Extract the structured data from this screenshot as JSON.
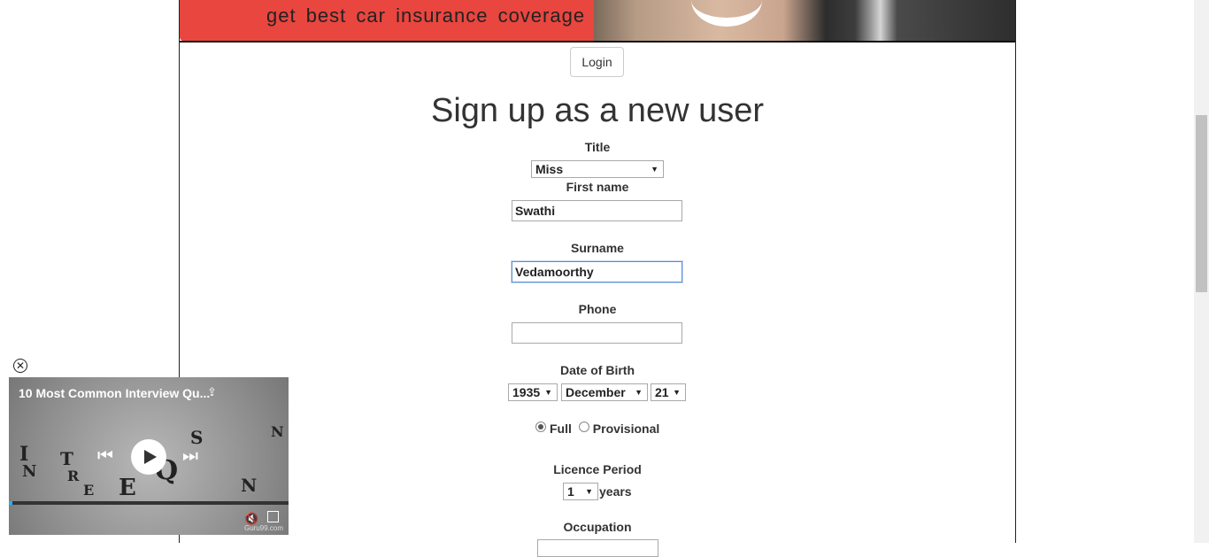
{
  "banner": {
    "tagline": "get best car insurance coverage"
  },
  "header": {
    "login_label": "Login"
  },
  "form": {
    "heading": "Sign up as a new user",
    "title_label": "Title",
    "title_value": "Miss",
    "first_name_label": "First name",
    "first_name_value": "Swathi",
    "surname_label": "Surname",
    "surname_value": "Vedamoorthy",
    "phone_label": "Phone",
    "phone_value": "",
    "dob_label": "Date of Birth",
    "dob_year": "1935",
    "dob_month": "December",
    "dob_day": "21",
    "licence_type_options": [
      "Full",
      "Provisional"
    ],
    "licence_type_selected": "Full",
    "licence_period_label": "Licence Period",
    "licence_period_value": "1",
    "licence_period_unit": "years",
    "occupation_label": "Occupation"
  },
  "video_player": {
    "title": "10 Most Common Interview Qu...",
    "progress": 0.01,
    "watermark": "Guru99.com",
    "icons": [
      "close-icon",
      "share-icon",
      "previous-icon",
      "play-icon",
      "next-icon",
      "mute-icon",
      "fullscreen-icon"
    ]
  },
  "colors": {
    "banner_red": "#e8463f",
    "focus_border": "#5b8fd6",
    "progress": "#1fb2ff"
  }
}
